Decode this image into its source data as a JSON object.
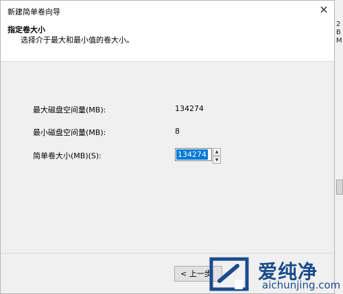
{
  "window": {
    "title": "新建简单卷向导",
    "close_glyph": "×"
  },
  "header": {
    "title": "指定卷大小",
    "subtitle": "选择介于最大和最小值的卷大小。"
  },
  "fields": {
    "max_label": "最大磁盘空间量(MB):",
    "max_value": "134274",
    "min_label": "最小磁盘空间量(MB):",
    "min_value": "8",
    "size_label": "简单卷大小(MB)(S):",
    "size_value": "134274"
  },
  "buttons": {
    "back_label": "< 上一步"
  },
  "background_window": {
    "chars": [
      "2",
      "B",
      "M"
    ]
  },
  "watermark": {
    "brand": "爱纯净",
    "url": "aichunjing.com"
  },
  "colors": {
    "selection": "#0078d7",
    "watermark": "#1a4b8c"
  },
  "icons": {
    "close": "close-icon",
    "spin_up": "chevron-up-icon",
    "spin_down": "chevron-down-icon"
  }
}
